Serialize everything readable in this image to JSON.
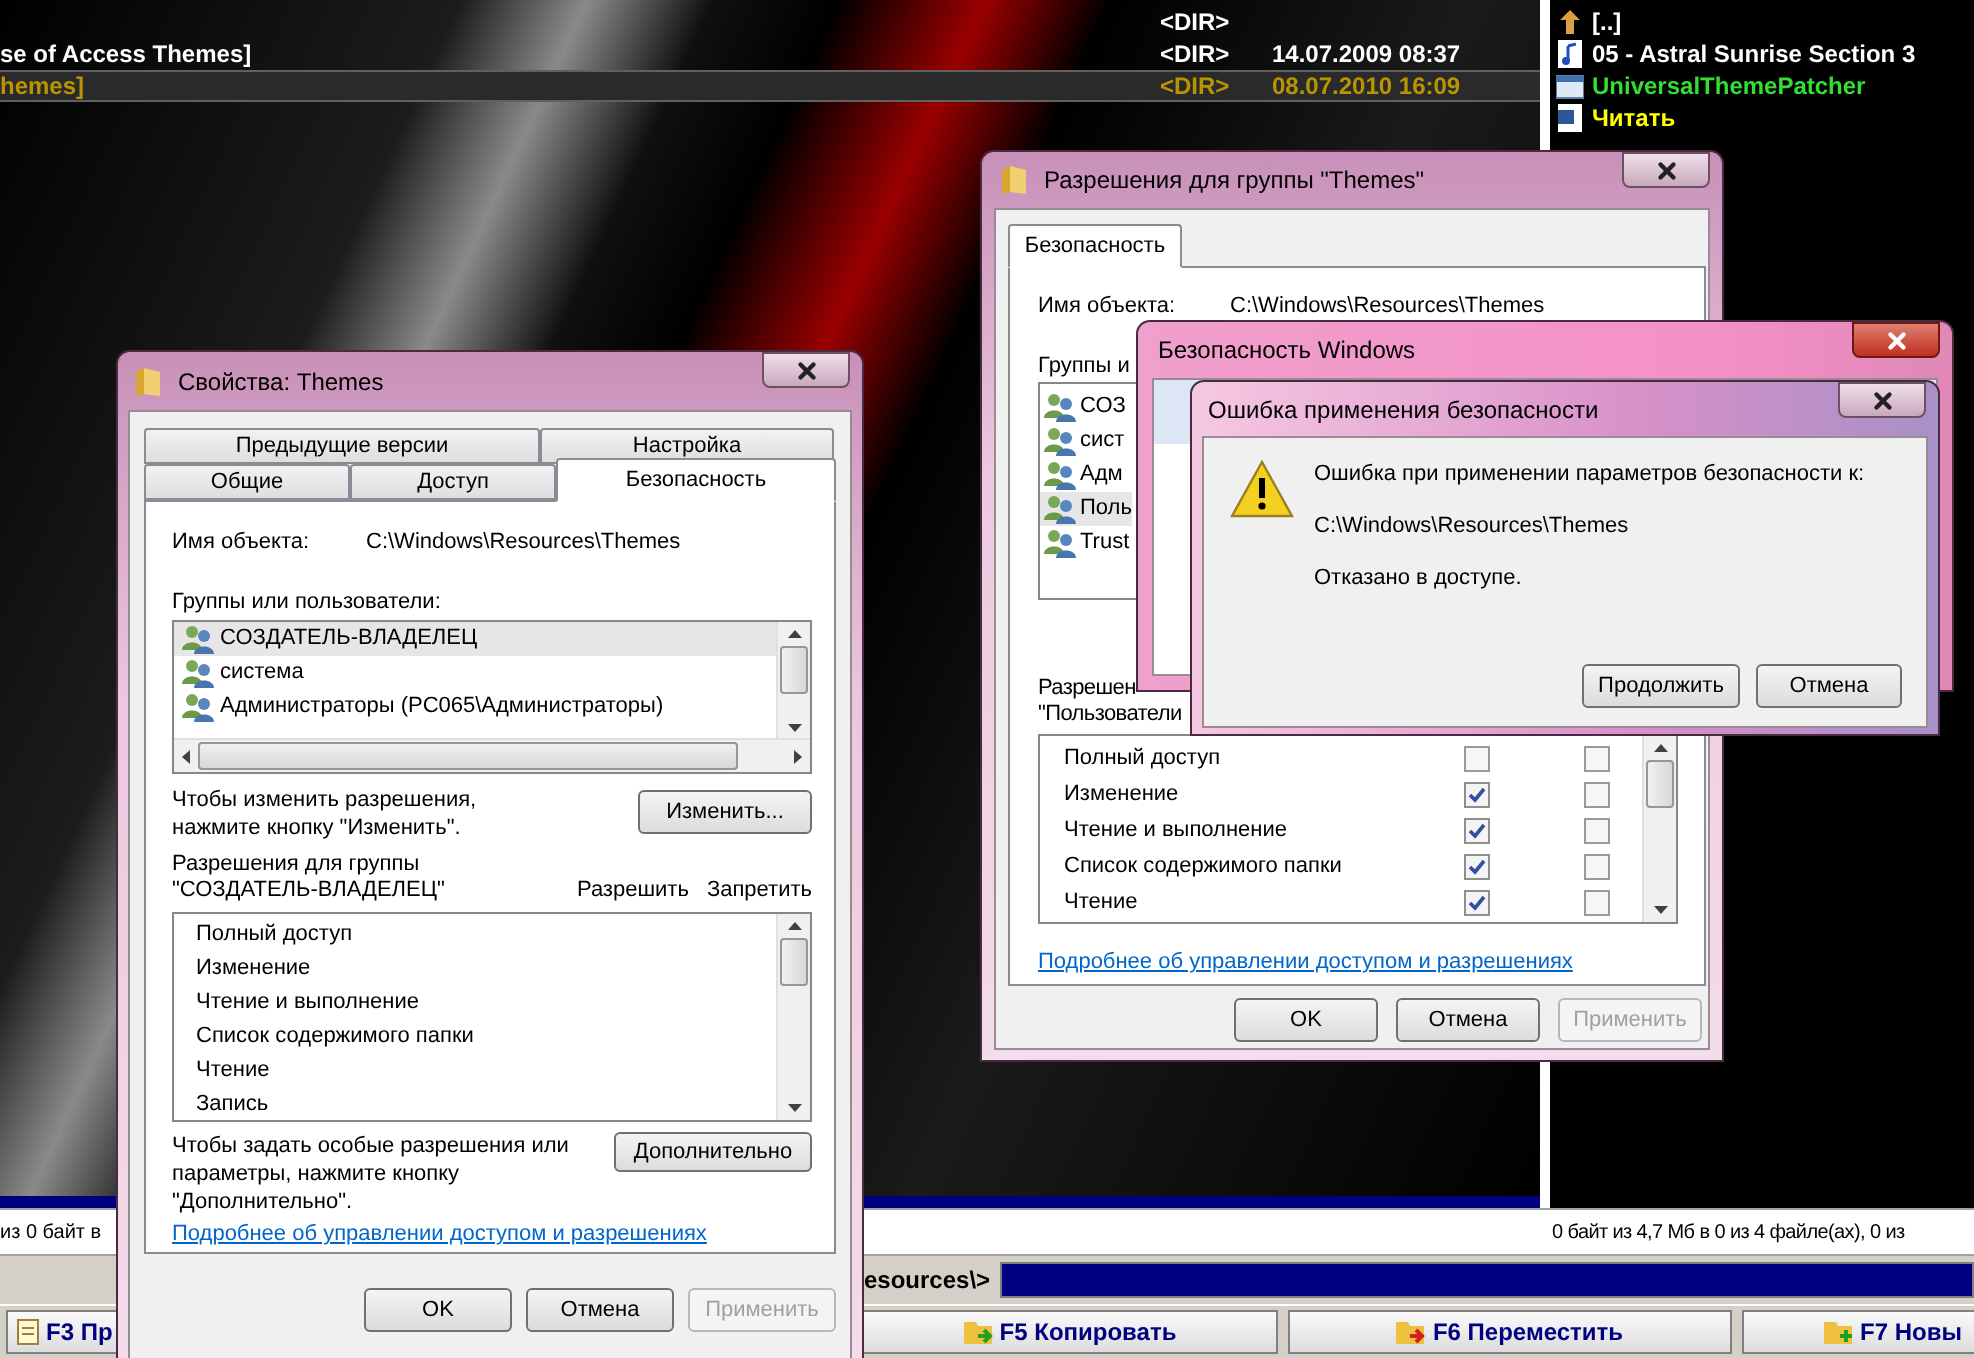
{
  "file_manager": {
    "left_panel": {
      "rows": [
        {
          "type": "<DIR>",
          "selected": false
        },
        {
          "name": "se of Access Themes]",
          "type": "<DIR>",
          "date": "14.07.2009 08:37",
          "selected": false
        },
        {
          "name": "hemes]",
          "type": "<DIR>",
          "date": "08.07.2010 16:09",
          "selected": true
        }
      ]
    },
    "right_panel": {
      "rows": [
        {
          "name": "[..]",
          "kind": "up",
          "color": "#ffffff"
        },
        {
          "name": "05 - Astral Sunrise Section 3",
          "kind": "audio",
          "color": "#ffffff"
        },
        {
          "name": "UniversalThemePatcher",
          "kind": "app",
          "color": "#33dd33"
        },
        {
          "name": "Читать",
          "kind": "document",
          "color": "#ffff00"
        }
      ]
    },
    "left_status": "из 0 байт в",
    "right_status": "0 байт из 4,7 Мб в 0 из 4 файле(ах), 0 из",
    "command_path": "esources\\>",
    "function_keys": [
      {
        "label": "F3 Пр",
        "kind": "view"
      },
      {
        "label": "F5 Копировать",
        "kind": "copy"
      },
      {
        "label": "F6 Переместить",
        "kind": "move"
      },
      {
        "label": "F7 Новы",
        "kind": "new"
      }
    ]
  },
  "properties_dialog": {
    "title": "Свойства: Themes",
    "tab_rows": [
      [
        {
          "label": "Предыдущие версии",
          "selected": false
        },
        {
          "label": "Настройка",
          "selected": false
        }
      ],
      [
        {
          "label": "Общие",
          "selected": false
        },
        {
          "label": "Доступ",
          "selected": false
        },
        {
          "label": "Безопасность",
          "selected": true
        }
      ]
    ],
    "object_label": "Имя объекта:",
    "object_path": "C:\\Windows\\Resources\\Themes",
    "groups_label": "Группы или пользователи:",
    "groups": [
      {
        "name": "СОЗДАТЕЛЬ-ВЛАДЕЛЕЦ",
        "selected": true
      },
      {
        "name": "система",
        "selected": false
      },
      {
        "name": "Администраторы (PC065\\Администраторы)",
        "selected": false
      }
    ],
    "change_hint": "Чтобы изменить разрешения, нажмите кнопку \"Изменить\".",
    "change_button": "Изменить...",
    "permissions_label": "Разрешения для группы \"СОЗДАТЕЛЬ-ВЛАДЕЛЕЦ\"",
    "allow_label": "Разрешить",
    "deny_label": "Запретить",
    "permissions": [
      {
        "name": "Полный доступ"
      },
      {
        "name": "Изменение"
      },
      {
        "name": "Чтение и выполнение"
      },
      {
        "name": "Список содержимого папки"
      },
      {
        "name": "Чтение"
      },
      {
        "name": "Запись"
      }
    ],
    "advanced_hint": "Чтобы задать особые разрешения или параметры, нажмите кнопку \"Дополнительно\".",
    "advanced_button": "Дополнительно",
    "link": "Подробнее об управлении доступом и разрешениях",
    "buttons": [
      {
        "label": "OK",
        "disabled": false
      },
      {
        "label": "Отмена",
        "disabled": false
      },
      {
        "label": "Применить",
        "disabled": true
      }
    ]
  },
  "permission_dialog": {
    "title": "Разрешения для группы \"Themes\"",
    "tabs": [
      {
        "label": "Безопасность",
        "selected": true
      }
    ],
    "object_label": "Имя объекта:",
    "object_path": "C:\\Windows\\Resources\\Themes",
    "groups_label": "Группы и",
    "groups": [
      {
        "name": "СОЗ",
        "selected": false
      },
      {
        "name": "сист",
        "selected": false
      },
      {
        "name": "Адм",
        "selected": false
      },
      {
        "name": "Поль",
        "selected": true
      },
      {
        "name": "Trust",
        "selected": false
      }
    ],
    "permissions_label": [
      "Разрешен",
      "\"Пользователи"
    ],
    "permissions": [
      {
        "name": "Полный доступ",
        "allow": false,
        "deny": false
      },
      {
        "name": "Изменение",
        "allow": true,
        "deny": false
      },
      {
        "name": "Чтение и выполнение",
        "allow": true,
        "deny": false
      },
      {
        "name": "Список содержимого папки",
        "allow": true,
        "deny": false
      },
      {
        "name": "Чтение",
        "allow": true,
        "deny": false
      }
    ],
    "link": "Подробнее об управлении доступом и разрешениях",
    "buttons": [
      {
        "label": "OK",
        "disabled": false
      },
      {
        "label": "Отмена",
        "disabled": false
      },
      {
        "label": "Применить",
        "disabled": true
      }
    ]
  },
  "security_window": {
    "title": "Безопасность Windows"
  },
  "error_dialog": {
    "title": "Ошибка применения безопасности",
    "message": "Ошибка при применении параметров безопасности к:",
    "path": "C:\\Windows\\Resources\\Themes",
    "detail": "Отказано в доступе.",
    "buttons": [
      {
        "label": "Продолжить",
        "disabled": false
      },
      {
        "label": "Отмена",
        "disabled": false
      }
    ]
  }
}
